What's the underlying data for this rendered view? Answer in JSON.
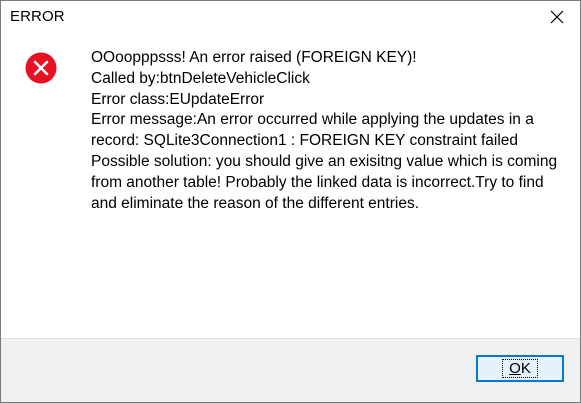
{
  "window": {
    "title": "ERROR",
    "close_icon": "close-icon"
  },
  "message": {
    "icon": "error-icon",
    "icon_color": "#e81123",
    "lines": [
      "OOoopppsss! An error raised (FOREIGN KEY)!",
      "Called by:btnDeleteVehicleClick",
      "Error class:EUpdateError",
      "Error message:An error occurred while applying the updates in a record: SQLite3Connection1 : FOREIGN KEY constraint failed",
      "Possible solution: you should give an exisitng value which is coming from another table! Probably the linked data is incorrect.Try to find and eliminate the reason of the different entries."
    ]
  },
  "footer": {
    "ok_accel": "O",
    "ok_rest": "K",
    "accent": "#0078d7"
  }
}
